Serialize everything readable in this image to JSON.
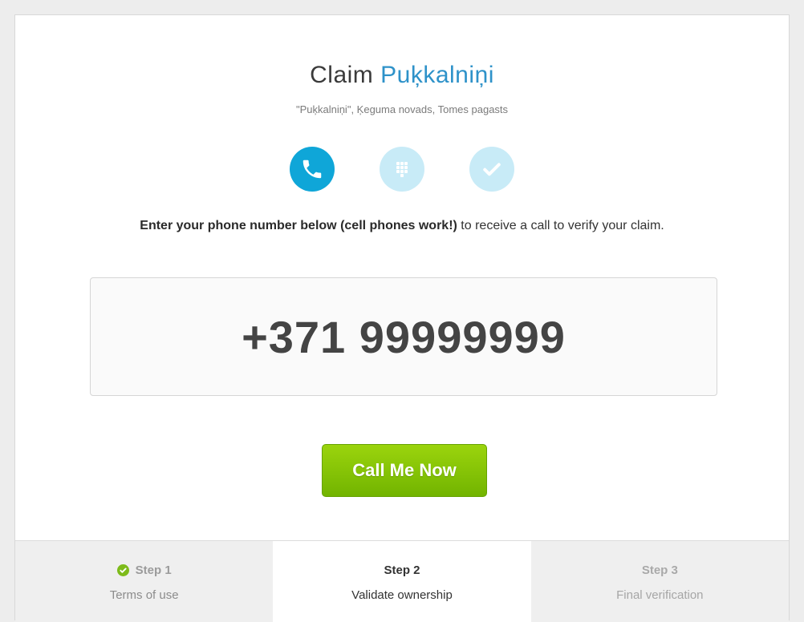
{
  "header": {
    "title_prefix": "Claim",
    "title_name": "Puķkalniņi",
    "subtitle": "\"Puķkalniņi\", Ķeguma novads, Tomes pagasts"
  },
  "progress_icons": [
    {
      "icon": "phone-icon",
      "state": "active"
    },
    {
      "icon": "keypad-icon",
      "state": "inactive"
    },
    {
      "icon": "checkmark-icon",
      "state": "inactive"
    }
  ],
  "instructions": {
    "bold": "Enter your phone number below (cell phones work!)",
    "rest": " to receive a call to verify your claim."
  },
  "phone": {
    "number": "+371 99999999"
  },
  "call_button": {
    "label": "Call Me Now"
  },
  "steps": [
    {
      "title": "Step 1",
      "desc": "Terms of use",
      "state": "done"
    },
    {
      "title": "Step 2",
      "desc": "Validate ownership",
      "state": "current"
    },
    {
      "title": "Step 3",
      "desc": "Final verification",
      "state": "future"
    }
  ],
  "colors": {
    "accent_blue": "#2e92c9",
    "icon_active": "#0fa6d8",
    "icon_inactive": "#c8ebf7",
    "button_green": "#7dc000",
    "done_green": "#7dbb1a"
  }
}
